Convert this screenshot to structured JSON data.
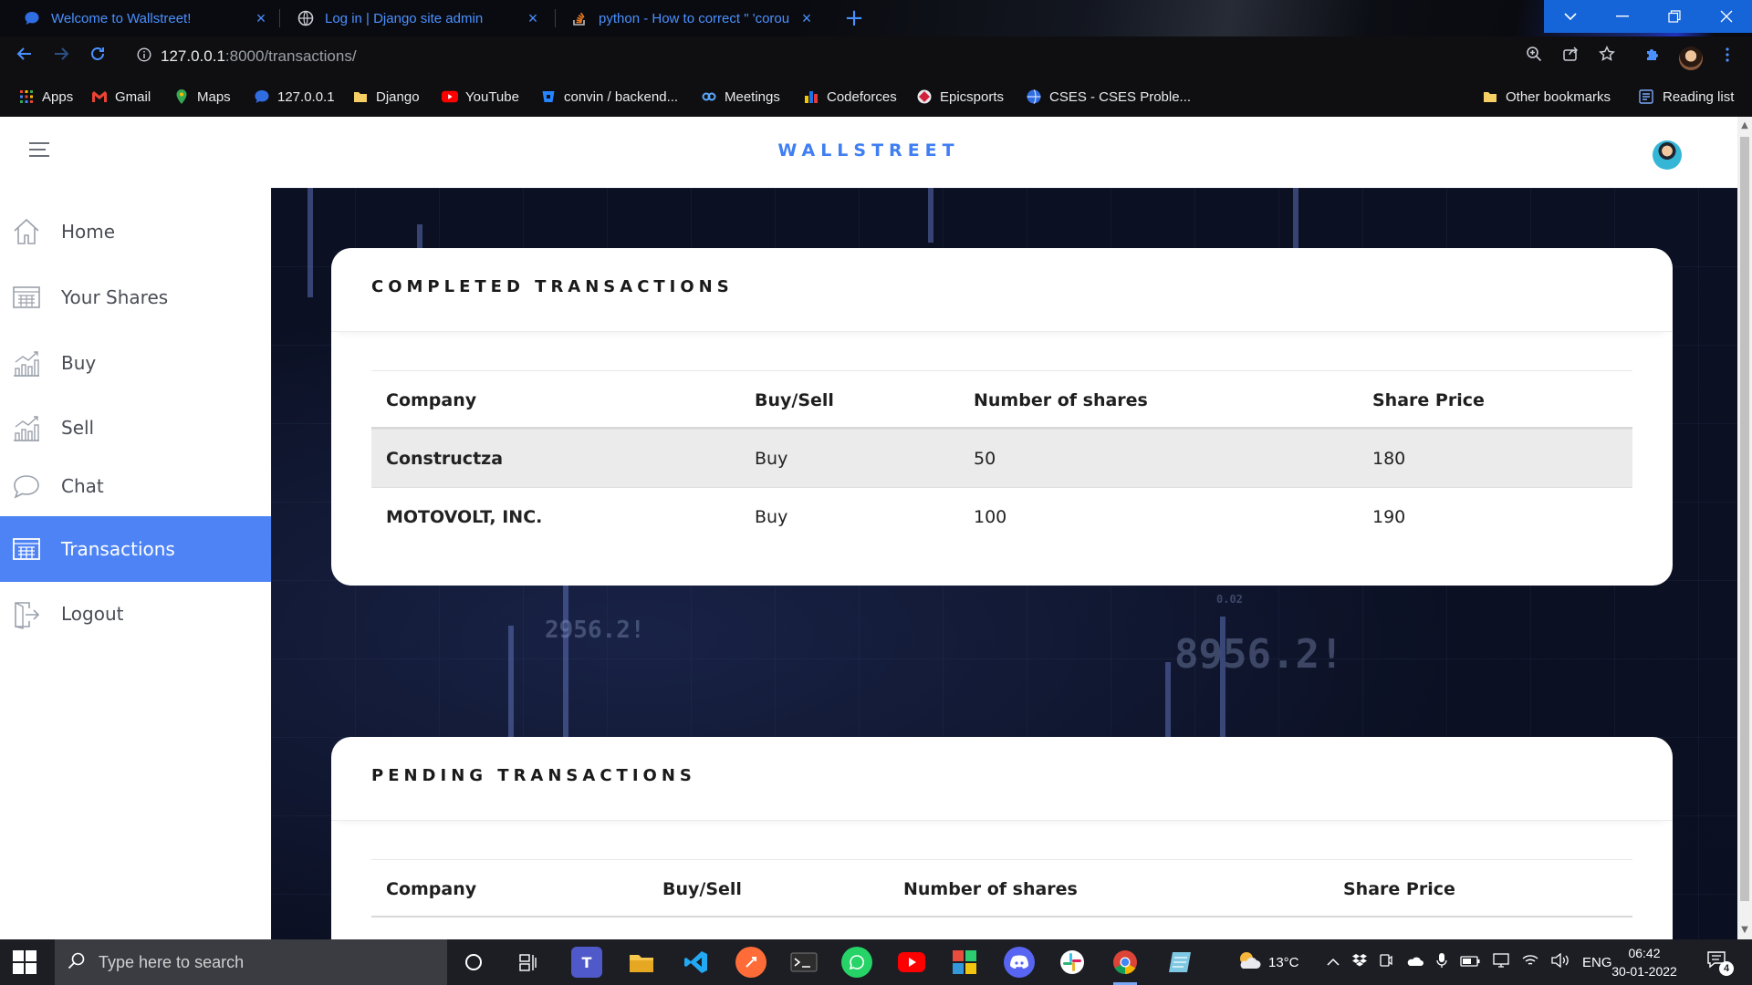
{
  "browser": {
    "tabs": [
      {
        "title": "Welcome to Wallstreet!",
        "icon": "chat-bubble-icon",
        "close": "×"
      },
      {
        "title": "Log in | Django site admin",
        "icon": "globe-icon",
        "close": "×"
      },
      {
        "title": "python - How to correct \" 'corou",
        "icon": "stackoverflow-icon",
        "close": "×"
      }
    ],
    "new_tab": "+",
    "url_host": "127.0.0.1",
    "url_path": ":8000/transactions/",
    "bookmarks": [
      {
        "label": "Apps",
        "icon": "apps-grid-icon"
      },
      {
        "label": "Gmail",
        "icon": "gmail-icon"
      },
      {
        "label": "Maps",
        "icon": "maps-pin-icon"
      },
      {
        "label": "127.0.0.1",
        "icon": "chat-bubble-icon"
      },
      {
        "label": "Django",
        "icon": "folder-icon"
      },
      {
        "label": "YouTube",
        "icon": "youtube-icon"
      },
      {
        "label": "convin / backend...",
        "icon": "bitbucket-icon"
      },
      {
        "label": "Meetings",
        "icon": "meetings-icon"
      },
      {
        "label": "Codeforces",
        "icon": "codeforces-icon"
      },
      {
        "label": "Epicsports",
        "icon": "epicsports-icon"
      },
      {
        "label": "CSES - CSES Proble...",
        "icon": "globe-icon"
      }
    ],
    "other_bookmarks": "Other bookmarks",
    "reading_list": "Reading list"
  },
  "app": {
    "brand": "WALLSTREET",
    "nav": [
      {
        "label": "Home",
        "icon": "home-icon",
        "active": false
      },
      {
        "label": "Your Shares",
        "icon": "table-icon",
        "active": false
      },
      {
        "label": "Buy",
        "icon": "chart-up-icon",
        "active": false
      },
      {
        "label": "Sell",
        "icon": "chart-down-icon",
        "active": false
      },
      {
        "label": "Chat",
        "icon": "chat-icon",
        "active": false
      },
      {
        "label": "Transactions",
        "icon": "table-icon",
        "active": true
      },
      {
        "label": "Logout",
        "icon": "logout-icon",
        "active": false
      }
    ]
  },
  "completed": {
    "title": "COMPLETED TRANSACTIONS",
    "columns": [
      "Company",
      "Buy/Sell",
      "Number of shares",
      "Share Price"
    ],
    "rows": [
      [
        "Constructza",
        "Buy",
        "50",
        "180"
      ],
      [
        "MOTOVOLT, INC.",
        "Buy",
        "100",
        "190"
      ]
    ]
  },
  "pending": {
    "title": "PENDING TRANSACTIONS",
    "columns": [
      "Company",
      "Buy/Sell",
      "Number of shares",
      "Share Price"
    ],
    "rows": []
  },
  "background_numbers": [
    "2956.2!",
    "8956.2!",
    "0.02"
  ],
  "taskbar": {
    "search_placeholder": "Type here to search",
    "temperature": "13°C",
    "language": "ENG",
    "time": "06:42",
    "date": "30-01-2022",
    "notification_count": "4"
  },
  "colors": {
    "accent": "#4d83f5",
    "brand": "#3f7ef3",
    "tab_text": "#4a90ff",
    "window_controls": "#1665d8"
  }
}
